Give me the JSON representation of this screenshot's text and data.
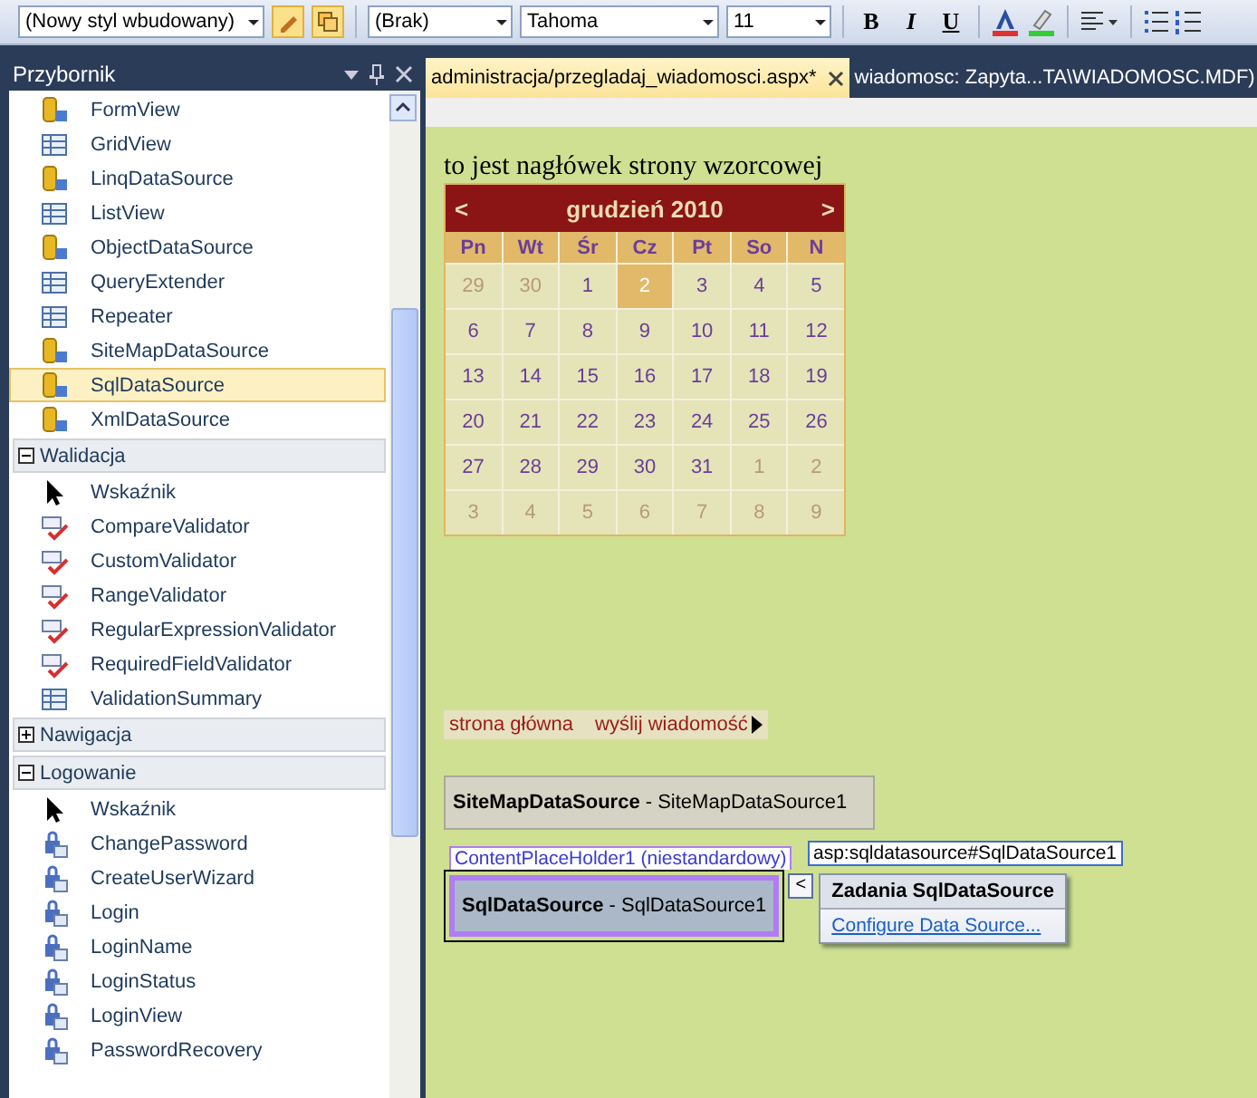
{
  "toolbar": {
    "style_combo": "(Nowy styl wbudowany)",
    "class_combo": "(Brak)",
    "font_combo": "Tahoma",
    "size_combo": "11",
    "format_buttons": [
      "B",
      "I",
      "U"
    ]
  },
  "toolbox": {
    "title": "Przybornik",
    "items": [
      {
        "label": "FormView",
        "kind": "data",
        "selected": false
      },
      {
        "label": "GridView",
        "kind": "grid",
        "selected": false
      },
      {
        "label": "LinqDataSource",
        "kind": "data",
        "selected": false
      },
      {
        "label": "ListView",
        "kind": "grid",
        "selected": false
      },
      {
        "label": "ObjectDataSource",
        "kind": "data",
        "selected": false
      },
      {
        "label": "QueryExtender",
        "kind": "grid",
        "selected": false
      },
      {
        "label": "Repeater",
        "kind": "grid",
        "selected": false
      },
      {
        "label": "SiteMapDataSource",
        "kind": "data",
        "selected": false
      },
      {
        "label": "SqlDataSource",
        "kind": "data",
        "selected": true
      },
      {
        "label": "XmlDataSource",
        "kind": "data",
        "selected": false
      },
      {
        "label": "Walidacja",
        "kind": "group",
        "expanded": true
      },
      {
        "label": "Wskaźnik",
        "kind": "pointer",
        "selected": false
      },
      {
        "label": "CompareValidator",
        "kind": "validator",
        "selected": false
      },
      {
        "label": "CustomValidator",
        "kind": "validator",
        "selected": false
      },
      {
        "label": "RangeValidator",
        "kind": "validator",
        "selected": false
      },
      {
        "label": "RegularExpressionValidator",
        "kind": "validator",
        "selected": false
      },
      {
        "label": "RequiredFieldValidator",
        "kind": "validator",
        "selected": false
      },
      {
        "label": "ValidationSummary",
        "kind": "grid",
        "selected": false
      },
      {
        "label": "Nawigacja",
        "kind": "group",
        "expanded": false
      },
      {
        "label": "Logowanie",
        "kind": "group",
        "expanded": true
      },
      {
        "label": "Wskaźnik",
        "kind": "pointer",
        "selected": false
      },
      {
        "label": "ChangePassword",
        "kind": "login",
        "selected": false
      },
      {
        "label": "CreateUserWizard",
        "kind": "login",
        "selected": false
      },
      {
        "label": "Login",
        "kind": "login",
        "selected": false
      },
      {
        "label": "LoginName",
        "kind": "login",
        "selected": false
      },
      {
        "label": "LoginStatus",
        "kind": "login",
        "selected": false
      },
      {
        "label": "LoginView",
        "kind": "login",
        "selected": false
      },
      {
        "label": "PasswordRecovery",
        "kind": "login",
        "selected": false
      }
    ]
  },
  "tabs": [
    {
      "label": "administracja/przegladaj_wiadomosci.aspx*",
      "selected": true
    },
    {
      "label": "wiadomosc: Zapyta...TA\\WIADOMOSC.MDF)",
      "selected": false
    }
  ],
  "page": {
    "header": "to jest nagłówek strony wzorcowej",
    "calendar": {
      "prev": "<",
      "title": "grudzień 2010",
      "next": ">",
      "weekdays": [
        "Pn",
        "Wt",
        "Śr",
        "Cz",
        "Pt",
        "So",
        "N"
      ],
      "weeks": [
        [
          {
            "day": "29",
            "other_month": true,
            "selected": false
          },
          {
            "day": "30",
            "other_month": true,
            "selected": false
          },
          {
            "day": "1",
            "other_month": false,
            "selected": false
          },
          {
            "day": "2",
            "other_month": false,
            "selected": true
          },
          {
            "day": "3",
            "other_month": false,
            "selected": false
          },
          {
            "day": "4",
            "other_month": false,
            "selected": false
          },
          {
            "day": "5",
            "other_month": false,
            "selected": false
          }
        ],
        [
          {
            "day": "6",
            "other_month": false,
            "selected": false
          },
          {
            "day": "7",
            "other_month": false,
            "selected": false
          },
          {
            "day": "8",
            "other_month": false,
            "selected": false
          },
          {
            "day": "9",
            "other_month": false,
            "selected": false
          },
          {
            "day": "10",
            "other_month": false,
            "selected": false
          },
          {
            "day": "11",
            "other_month": false,
            "selected": false
          },
          {
            "day": "12",
            "other_month": false,
            "selected": false
          }
        ],
        [
          {
            "day": "13",
            "other_month": false,
            "selected": false
          },
          {
            "day": "14",
            "other_month": false,
            "selected": false
          },
          {
            "day": "15",
            "other_month": false,
            "selected": false
          },
          {
            "day": "16",
            "other_month": false,
            "selected": false
          },
          {
            "day": "17",
            "other_month": false,
            "selected": false
          },
          {
            "day": "18",
            "other_month": false,
            "selected": false
          },
          {
            "day": "19",
            "other_month": false,
            "selected": false
          }
        ],
        [
          {
            "day": "20",
            "other_month": false,
            "selected": false
          },
          {
            "day": "21",
            "other_month": false,
            "selected": false
          },
          {
            "day": "22",
            "other_month": false,
            "selected": false
          },
          {
            "day": "23",
            "other_month": false,
            "selected": false
          },
          {
            "day": "24",
            "other_month": false,
            "selected": false
          },
          {
            "day": "25",
            "other_month": false,
            "selected": false
          },
          {
            "day": "26",
            "other_month": false,
            "selected": false
          }
        ],
        [
          {
            "day": "27",
            "other_month": false,
            "selected": false
          },
          {
            "day": "28",
            "other_month": false,
            "selected": false
          },
          {
            "day": "29",
            "other_month": false,
            "selected": false
          },
          {
            "day": "30",
            "other_month": false,
            "selected": false
          },
          {
            "day": "31",
            "other_month": false,
            "selected": false
          },
          {
            "day": "1",
            "other_month": true,
            "selected": false
          },
          {
            "day": "2",
            "other_month": true,
            "selected": false
          }
        ],
        [
          {
            "day": "3",
            "other_month": true,
            "selected": false
          },
          {
            "day": "4",
            "other_month": true,
            "selected": false
          },
          {
            "day": "5",
            "other_month": true,
            "selected": false
          },
          {
            "day": "6",
            "other_month": true,
            "selected": false
          },
          {
            "day": "7",
            "other_month": true,
            "selected": false
          },
          {
            "day": "8",
            "other_month": true,
            "selected": false
          },
          {
            "day": "9",
            "other_month": true,
            "selected": false
          }
        ]
      ]
    },
    "menu": [
      "strona główna",
      "wyślij wiadomość"
    ],
    "sitemap_control": "**SiteMapDataSource** - SiteMapDataSource1",
    "placeholder_tag": "ContentPlaceHolder1 (niestandardowy)",
    "sql_control": "**SqlDataSource** - SqlDataSource1",
    "element_tag": "asp:sqldatasource#SqlDataSource1",
    "smart_tag": "<",
    "tasks": {
      "title": "Zadania SqlDataSource",
      "link": "Configure Data Source..."
    }
  }
}
